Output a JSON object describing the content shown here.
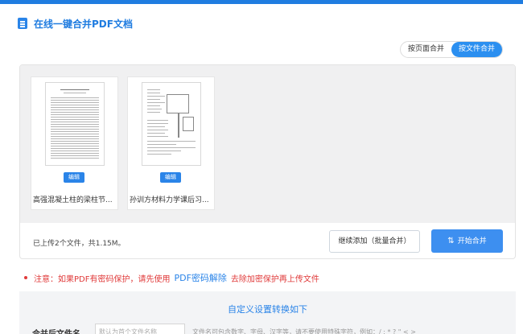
{
  "header": {
    "title": "在线一键合并PDF文档",
    "icon": "document-icon"
  },
  "mode_toggle": {
    "options": [
      {
        "label": "按页面合并",
        "active": false
      },
      {
        "label": "按文件合并",
        "active": true
      }
    ]
  },
  "files": [
    {
      "name": "高强混凝土柱的梁柱节...",
      "edit_label": "编辑"
    },
    {
      "name": "孙训方材料力学课后习...",
      "edit_label": "编辑"
    }
  ],
  "footer": {
    "status": "已上传2个文件，共1.15M。",
    "add_button": "继续添加（批量合并）",
    "merge_button": "开始合并"
  },
  "notice": {
    "prefix": "注意：如果PDF有密码保护，请先使用",
    "link": "PDF密码解除",
    "suffix": "去除加密保护再上传文件"
  },
  "settings": {
    "title": "自定义设置转换如下",
    "filename_label": "合并后文件名",
    "filename_placeholder": "默认为首个文件名称",
    "hint": "文件名可包含数字、字母、汉字等，请不要使用特殊字符，例如：/ : * ? \" < >"
  },
  "colors": {
    "accent": "#2a84e8",
    "notice": "#e03a3a",
    "panel_bg": "#f0f0f1"
  }
}
